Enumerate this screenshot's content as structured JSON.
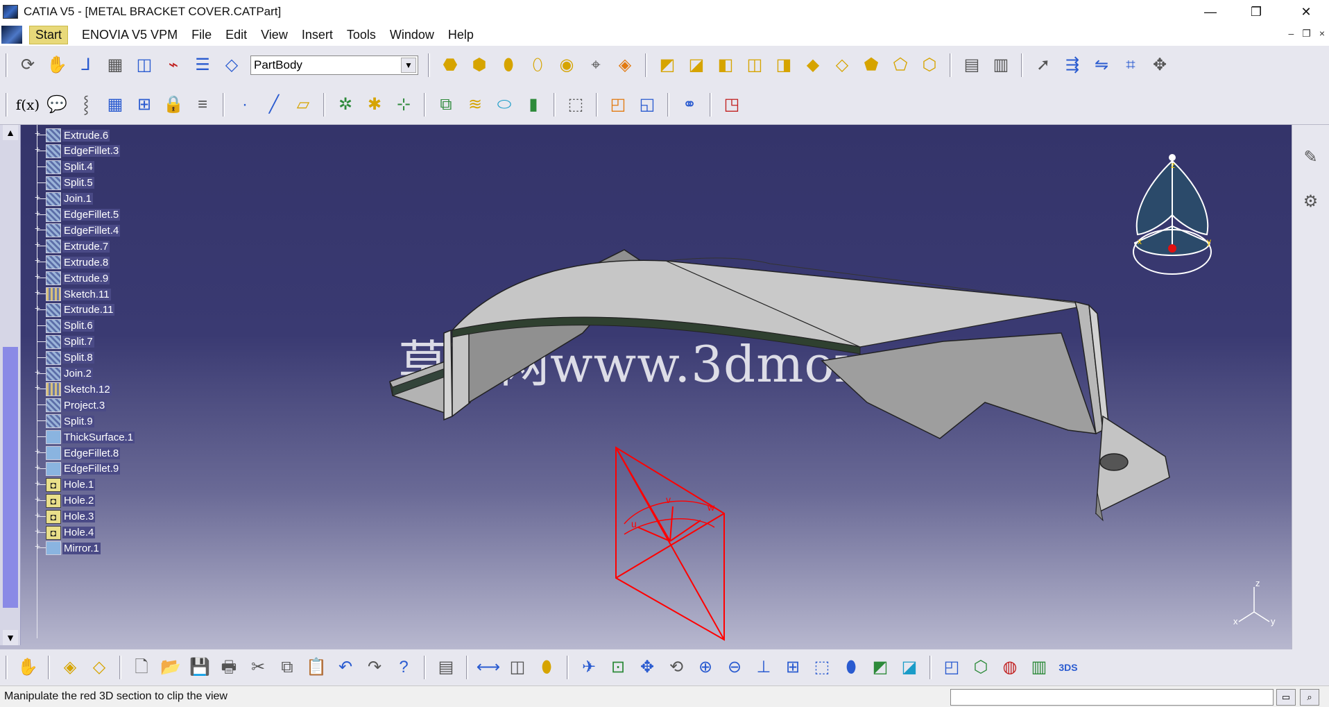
{
  "window": {
    "title": "CATIA V5 - [METAL BRACKET COVER.CATPart]",
    "minimize_glyph": "—",
    "maximize_glyph": "❐",
    "close_glyph": "✕"
  },
  "menubar": {
    "items": [
      "Start",
      "ENOVIA V5 VPM",
      "File",
      "Edit",
      "View",
      "Insert",
      "Tools",
      "Window",
      "Help"
    ],
    "mdi_minimize": "–",
    "mdi_restore": "❐",
    "mdi_close": "×"
  },
  "toolbar_top": {
    "body_select_value": "PartBody"
  },
  "tree": {
    "items": [
      {
        "label": "Extrude.6",
        "icon": "surface-feature-icon",
        "expandable": true
      },
      {
        "label": "EdgeFillet.3",
        "icon": "surface-feature-icon",
        "expandable": true
      },
      {
        "label": "Split.4",
        "icon": "surface-feature-icon",
        "expandable": false
      },
      {
        "label": "Split.5",
        "icon": "surface-feature-icon",
        "expandable": false
      },
      {
        "label": "Join.1",
        "icon": "surface-feature-icon",
        "expandable": true
      },
      {
        "label": "EdgeFillet.5",
        "icon": "surface-feature-icon",
        "expandable": true
      },
      {
        "label": "EdgeFillet.4",
        "icon": "surface-feature-icon",
        "expandable": true
      },
      {
        "label": "Extrude.7",
        "icon": "surface-feature-icon",
        "expandable": true
      },
      {
        "label": "Extrude.8",
        "icon": "surface-feature-icon",
        "expandable": true
      },
      {
        "label": "Extrude.9",
        "icon": "surface-feature-icon",
        "expandable": true
      },
      {
        "label": "Sketch.11",
        "icon": "sketch-icon",
        "expandable": true
      },
      {
        "label": "Extrude.11",
        "icon": "surface-feature-icon",
        "expandable": true
      },
      {
        "label": "Split.6",
        "icon": "surface-feature-icon",
        "expandable": false
      },
      {
        "label": "Split.7",
        "icon": "surface-feature-icon",
        "expandable": false
      },
      {
        "label": "Split.8",
        "icon": "surface-feature-icon",
        "expandable": false
      },
      {
        "label": "Join.2",
        "icon": "surface-feature-icon",
        "expandable": true
      },
      {
        "label": "Sketch.12",
        "icon": "sketch-icon",
        "expandable": true
      },
      {
        "label": "Project.3",
        "icon": "surface-feature-icon",
        "expandable": false
      },
      {
        "label": "Split.9",
        "icon": "surface-feature-icon",
        "expandable": false
      },
      {
        "label": "ThickSurface.1",
        "icon": "thick-surface-icon",
        "expandable": false
      },
      {
        "label": "EdgeFillet.8",
        "icon": "solid-fillet-icon",
        "expandable": true
      },
      {
        "label": "EdgeFillet.9",
        "icon": "solid-fillet-icon",
        "expandable": true
      },
      {
        "label": "Hole.1",
        "icon": "hole-icon",
        "expandable": true
      },
      {
        "label": "Hole.2",
        "icon": "hole-icon",
        "expandable": true
      },
      {
        "label": "Hole.3",
        "icon": "hole-icon",
        "expandable": true
      },
      {
        "label": "Hole.4",
        "icon": "hole-icon",
        "expandable": true
      },
      {
        "label": "Mirror.1",
        "icon": "mirror-icon",
        "expandable": true
      }
    ]
  },
  "viewport": {
    "watermark": "莫西网www.3dmox.com",
    "compass_labels": {
      "z": "z",
      "x": "x",
      "y": "y"
    },
    "axis_labels": {
      "z": "z",
      "x": "x",
      "y": "y"
    },
    "clip_box_labels": {
      "u": "u",
      "v": "v",
      "w": "w"
    },
    "part_color": "#c8c8c8",
    "clip_box_color": "#ff0000"
  },
  "statusbar": {
    "message": "Manipulate the red 3D section to clip the view",
    "command_input": ""
  },
  "colors": {
    "viewport_top": "#34346a",
    "viewport_bottom": "#b8b8cf",
    "toolbar_bg": "#e7e7ef"
  }
}
